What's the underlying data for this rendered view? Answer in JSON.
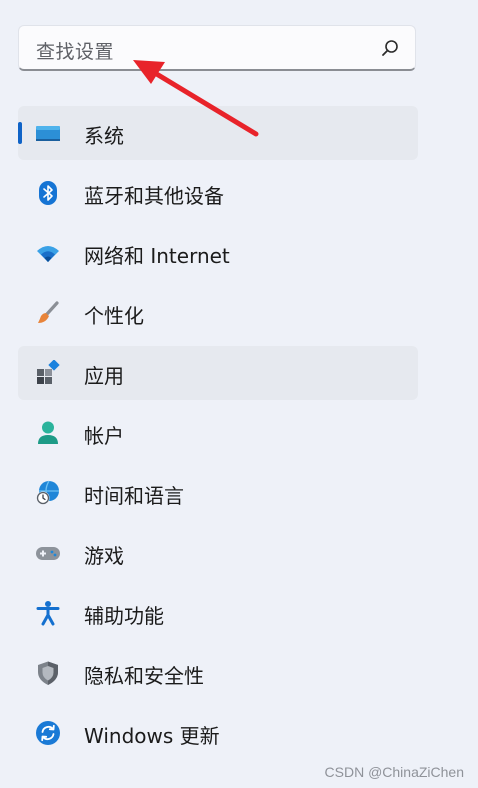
{
  "search": {
    "placeholder": "查找设置",
    "icon": "search-icon"
  },
  "nav": {
    "selected_index": 0,
    "hovered_index": 4,
    "items": [
      {
        "label": "系统",
        "icon": "system-display-icon"
      },
      {
        "label": "蓝牙和其他设备",
        "icon": "bluetooth-icon"
      },
      {
        "label": "网络和 Internet",
        "icon": "wifi-icon"
      },
      {
        "label": "个性化",
        "icon": "paintbrush-icon"
      },
      {
        "label": "应用",
        "icon": "apps-icon"
      },
      {
        "label": "帐户",
        "icon": "account-icon"
      },
      {
        "label": "时间和语言",
        "icon": "globe-clock-icon"
      },
      {
        "label": "游戏",
        "icon": "gamepad-icon"
      },
      {
        "label": "辅助功能",
        "icon": "accessibility-icon"
      },
      {
        "label": "隐私和安全性",
        "icon": "shield-icon"
      },
      {
        "label": "Windows 更新",
        "icon": "windows-update-icon"
      }
    ]
  },
  "annotation": {
    "arrow_color": "#e8232a"
  },
  "watermark": "CSDN @ChinaZiChen",
  "colors": {
    "background": "#eef1f8",
    "accent": "#0f63c7",
    "selected_background": "#e6e9ef"
  }
}
